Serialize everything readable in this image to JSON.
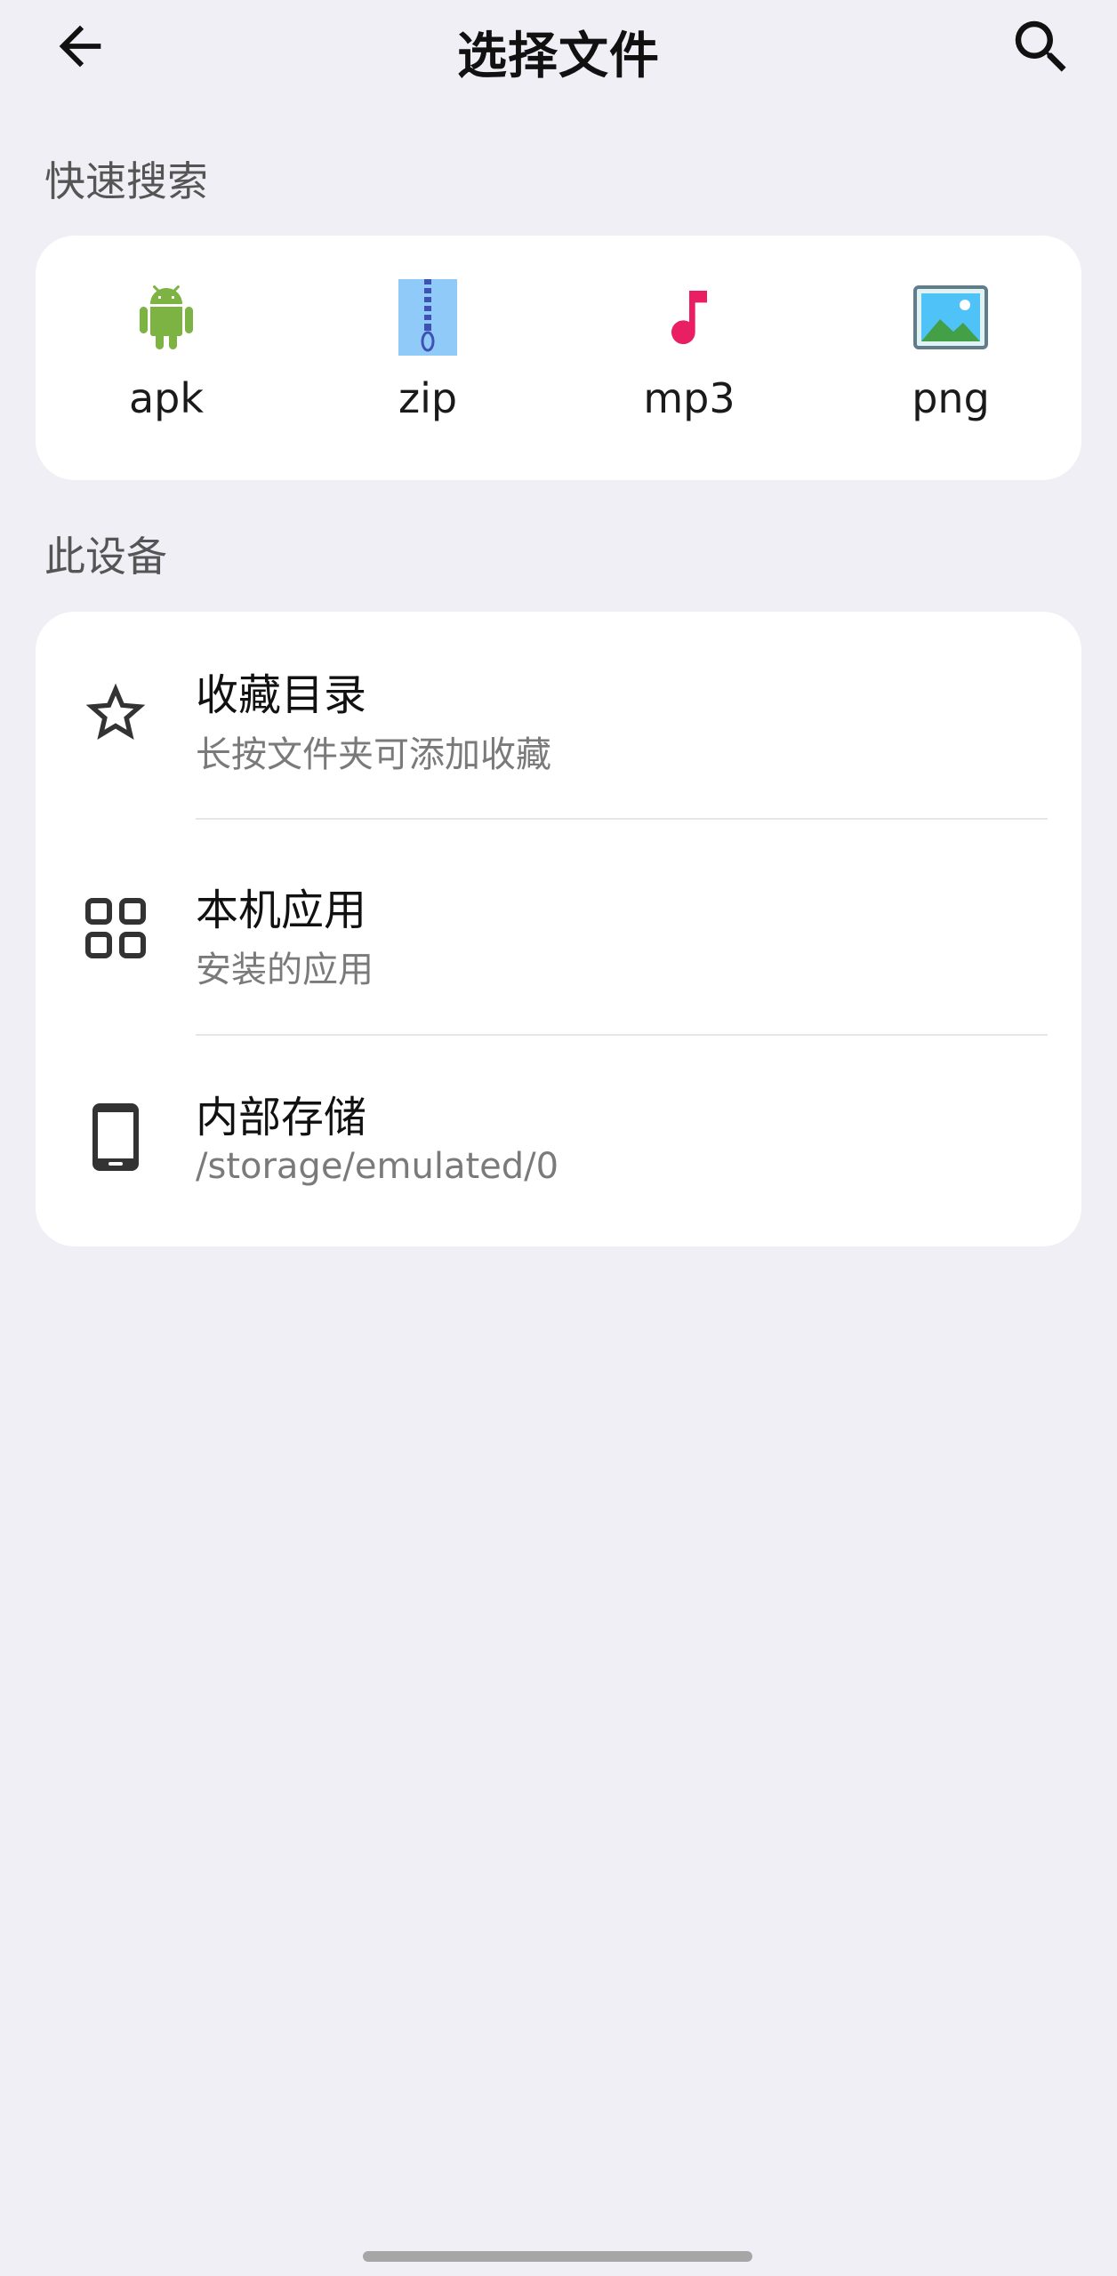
{
  "header": {
    "title": "选择文件",
    "back_icon": "arrow-left-icon",
    "search_icon": "search-icon"
  },
  "quick_search": {
    "label": "快速搜索",
    "items": [
      {
        "label": "apk",
        "icon": "android-icon",
        "color": "#7cb342"
      },
      {
        "label": "zip",
        "icon": "zip-archive-icon",
        "color": "#90caf9"
      },
      {
        "label": "mp3",
        "icon": "music-note-icon",
        "color": "#e91e63"
      },
      {
        "label": "png",
        "icon": "image-icon",
        "color": "#4caf50"
      }
    ]
  },
  "device": {
    "label": "此设备",
    "items": [
      {
        "title": "收藏目录",
        "subtitle": "长按文件夹可添加收藏",
        "icon": "star-outline-icon"
      },
      {
        "title": "本机应用",
        "subtitle": "安装的应用",
        "icon": "apps-grid-icon"
      },
      {
        "title": "内部存储",
        "subtitle": "/storage/emulated/0",
        "icon": "smartphone-icon"
      }
    ]
  },
  "colors": {
    "background": "#f0eff5",
    "card": "#ffffff",
    "text_primary": "#111111",
    "text_secondary": "#7a7a7a"
  }
}
